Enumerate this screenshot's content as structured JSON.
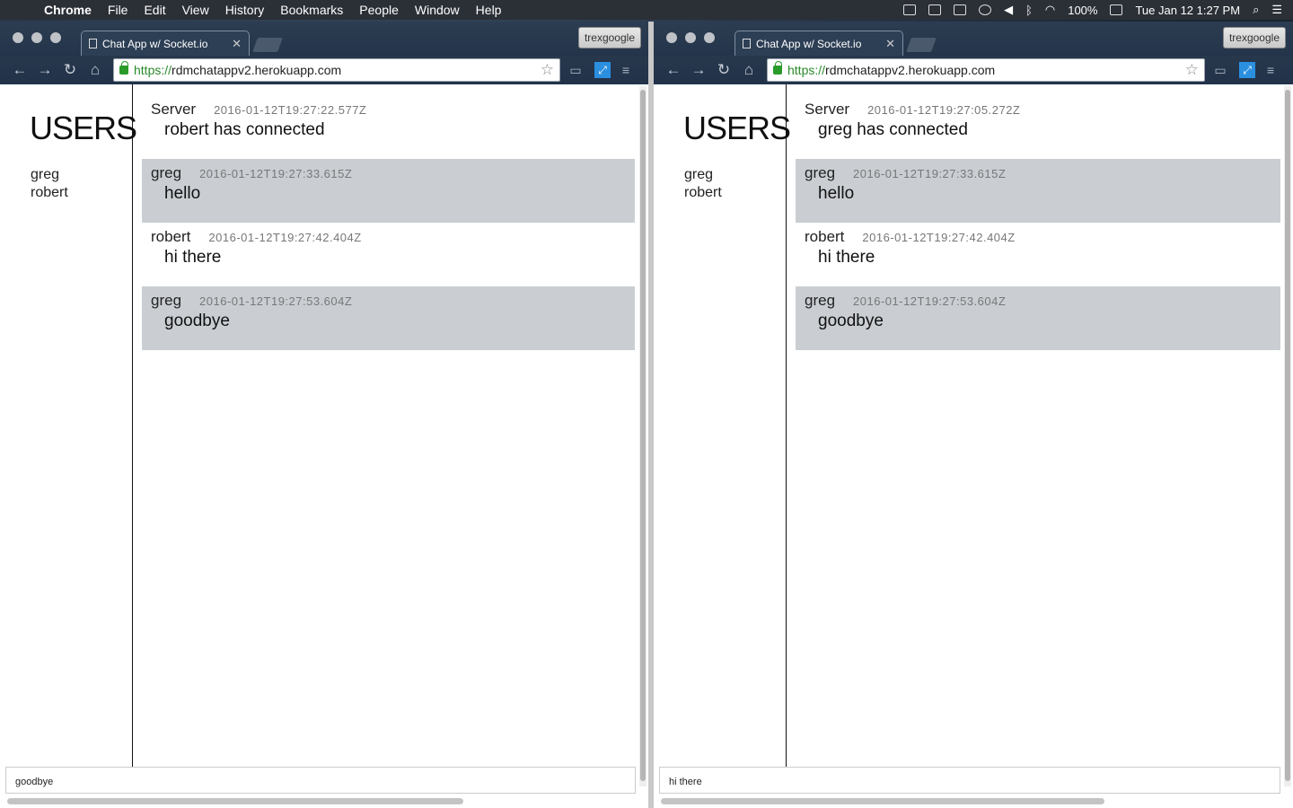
{
  "menubar": {
    "app": "Chrome",
    "items": [
      "File",
      "Edit",
      "View",
      "History",
      "Bookmarks",
      "People",
      "Window",
      "Help"
    ],
    "battery": "100%",
    "clock": "Tue Jan 12  1:27 PM"
  },
  "windows": [
    {
      "tab_title": "Chat App w/ Socket.io",
      "profile": "trexgoogle",
      "url_scheme": "https://",
      "url_host": "rdmchatappv2.herokuapp.com",
      "users_heading": "USERS",
      "users": [
        "greg",
        "robert"
      ],
      "messages": [
        {
          "user": "Server",
          "time": "2016-01-12T19:27:22.577Z",
          "text": "robert has connected"
        },
        {
          "user": "greg",
          "time": "2016-01-12T19:27:33.615Z",
          "text": "hello"
        },
        {
          "user": "robert",
          "time": "2016-01-12T19:27:42.404Z",
          "text": "hi there"
        },
        {
          "user": "greg",
          "time": "2016-01-12T19:27:53.604Z",
          "text": "goodbye"
        }
      ],
      "input_value": "goodbye"
    },
    {
      "tab_title": "Chat App w/ Socket.io",
      "profile": "trexgoogle",
      "url_scheme": "https://",
      "url_host": "rdmchatappv2.herokuapp.com",
      "users_heading": "USERS",
      "users": [
        "greg",
        "robert"
      ],
      "messages": [
        {
          "user": "Server",
          "time": "2016-01-12T19:27:05.272Z",
          "text": "greg has connected"
        },
        {
          "user": "greg",
          "time": "2016-01-12T19:27:33.615Z",
          "text": "hello"
        },
        {
          "user": "robert",
          "time": "2016-01-12T19:27:42.404Z",
          "text": "hi there"
        },
        {
          "user": "greg",
          "time": "2016-01-12T19:27:53.604Z",
          "text": "goodbye"
        }
      ],
      "input_value": "hi there"
    }
  ]
}
